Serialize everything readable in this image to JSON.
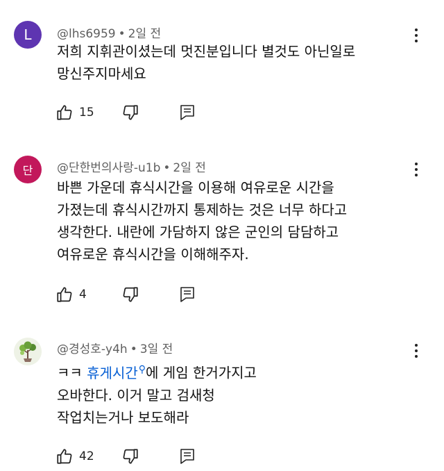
{
  "comments": [
    {
      "avatar_letter": "L",
      "avatar_color": "#5e35b1",
      "username": "@lhs6959",
      "time": "2일 전",
      "lines": [
        "저희 지휘관이셨는데 멋진분입니다 별것도 아닌일로",
        "망신주지마세요"
      ],
      "likes": "15"
    },
    {
      "avatar_letter": "단",
      "avatar_color": "#c2185b",
      "username": "@단한번의사랑-u1b",
      "time": "2일 전",
      "lines": [
        "바쁜 가운데 휴식시간을  이용해 여유로운  시간을",
        "가졌는데  휴식시간까지 통제하는 것은 너무 하다고",
        "생각한다. 내란에 가담하지 않은 군인의 담담하고",
        "여유로운 휴식시간을 이해해주자."
      ],
      "likes": "4"
    },
    {
      "avatar_icon": "tree-avatar-icon",
      "username": "@경성호-y4h",
      "time": "3일 전",
      "line1_prefix": "ㅋㅋ ",
      "line1_link": "휴게시간",
      "line1_suffix": "에 게임 한거가지고",
      "lines": [
        "오바한다. 이거 말고 검새청",
        "작업치는거나 보도해라"
      ],
      "likes": "42"
    }
  ],
  "separator": "•"
}
